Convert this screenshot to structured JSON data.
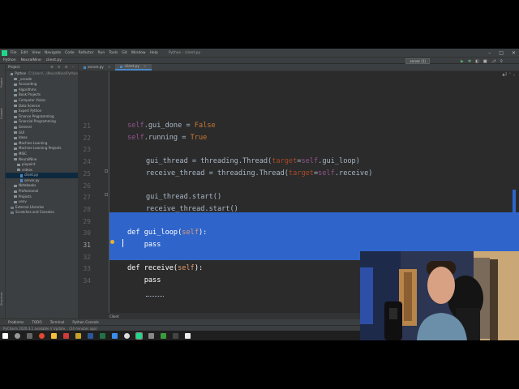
{
  "menubar": {
    "items": [
      "File",
      "Edit",
      "View",
      "Navigate",
      "Code",
      "Refactor",
      "Run",
      "Tools",
      "Git",
      "Window",
      "Help"
    ],
    "project_title": "Python - client.py"
  },
  "navbar": {
    "crumbs": [
      "Python",
      "NeuralNine",
      "client.py"
    ],
    "run_config": "server (1)"
  },
  "project_panel": {
    "title": "Project",
    "tree": [
      {
        "label": "Python",
        "path": "C:\\Users\\...\\NeuralNine\\Python",
        "type": "folder",
        "indent": 1
      },
      {
        "label": "_vscode",
        "type": "folder",
        "indent": 2
      },
      {
        "label": "Accounting",
        "type": "folder",
        "indent": 2
      },
      {
        "label": "Algorithms",
        "type": "folder",
        "indent": 2
      },
      {
        "label": "Book Projects",
        "type": "folder",
        "indent": 2
      },
      {
        "label": "Computer Vision",
        "type": "folder",
        "indent": 2
      },
      {
        "label": "Data Science",
        "type": "folder",
        "indent": 2
      },
      {
        "label": "Expert Python",
        "type": "folder",
        "indent": 2
      },
      {
        "label": "Finance Programming",
        "type": "folder",
        "indent": 2
      },
      {
        "label": "Financial Programming",
        "type": "folder",
        "indent": 2
      },
      {
        "label": "General",
        "type": "folder",
        "indent": 2
      },
      {
        "label": "GUI",
        "type": "folder",
        "indent": 2
      },
      {
        "label": "Ideas",
        "type": "folder",
        "indent": 2
      },
      {
        "label": "Machine Learning",
        "type": "folder",
        "indent": 2
      },
      {
        "label": "Machine Learning Projects",
        "type": "folder",
        "indent": 2
      },
      {
        "label": "MISC",
        "type": "folder",
        "indent": 2
      },
      {
        "label": "NeuralNine",
        "type": "folder",
        "indent": 2
      },
      {
        "label": "pinpoint",
        "type": "folder",
        "indent": 3
      },
      {
        "label": "videos",
        "type": "folder",
        "indent": 3
      },
      {
        "label": "client.py",
        "type": "file",
        "indent": 4,
        "selected": true
      },
      {
        "label": "server.py",
        "type": "file",
        "indent": 4
      },
      {
        "label": "Notebooks",
        "type": "folder",
        "indent": 2
      },
      {
        "label": "Professional",
        "type": "folder",
        "indent": 2
      },
      {
        "label": "Projects",
        "type": "folder",
        "indent": 2
      },
      {
        "label": "venv",
        "type": "folder",
        "indent": 2
      },
      {
        "label": "External Libraries",
        "type": "ext",
        "indent": 1
      },
      {
        "label": "Scratches and Consoles",
        "type": "ext",
        "indent": 1
      }
    ]
  },
  "tabs": [
    {
      "label": "server.py",
      "active": false
    },
    {
      "label": "client.py",
      "active": true
    }
  ],
  "editor": {
    "inspection": "▲2 ⌃ ⌄",
    "lines": [
      {
        "no": "21",
        "segs": [
          [
            "self",
            "self"
          ],
          [
            ".gui_done = ",
            ""
          ],
          [
            "False",
            "kw"
          ]
        ]
      },
      {
        "no": "22",
        "segs": [
          [
            "self",
            "self"
          ],
          [
            ".running = ",
            ""
          ],
          [
            "True",
            "kw"
          ]
        ]
      },
      {
        "no": "23",
        "segs": []
      },
      {
        "no": "24",
        "segs": [
          [
            "gui_thread = threading.Thread(",
            ""
          ],
          [
            "target",
            "param"
          ],
          [
            "=",
            ""
          ],
          [
            "self",
            "self"
          ],
          [
            ".gui_loop)",
            ""
          ]
        ]
      },
      {
        "no": "25",
        "segs": [
          [
            "receive_thread = threading.Thread(",
            ""
          ],
          [
            "target",
            "param"
          ],
          [
            "=",
            ""
          ],
          [
            "self",
            "self"
          ],
          [
            ".receive)",
            ""
          ]
        ]
      },
      {
        "no": "26",
        "segs": []
      },
      {
        "no": "27",
        "segs": [
          [
            "gui_thread.start()",
            ""
          ]
        ]
      },
      {
        "no": "28",
        "segs": [
          [
            "receive_thread.start()",
            ""
          ]
        ]
      },
      {
        "no": "29",
        "segs": []
      },
      {
        "no": "30",
        "segs": [
          [
            "def ",
            "sel-text"
          ],
          [
            "gui_loop",
            "sel-text"
          ],
          [
            "(",
            "sel-text"
          ],
          [
            "self",
            "sel-param"
          ],
          [
            "):",
            "sel-text"
          ]
        ]
      },
      {
        "no": "31",
        "segs": [
          [
            "    pass",
            "sel-text"
          ]
        ]
      },
      {
        "no": "32",
        "segs": []
      },
      {
        "no": "33",
        "segs": [
          [
            "def ",
            "sel-text"
          ],
          [
            "receive",
            "sel-text"
          ],
          [
            "(",
            "sel-text"
          ],
          [
            "self",
            "sel-param"
          ],
          [
            "):",
            "sel-text"
          ]
        ]
      },
      {
        "no": "34",
        "segs": [
          [
            "    pass",
            "sel-text"
          ]
        ]
      }
    ]
  },
  "structure_bar": {
    "label": "Client"
  },
  "bottom_tools": [
    "Problems",
    "TODO",
    "Terminal",
    "Python Console"
  ],
  "status_bar": {
    "text": "PyCharm 2020.3.1 available // Update... (24 minutes ago)"
  }
}
